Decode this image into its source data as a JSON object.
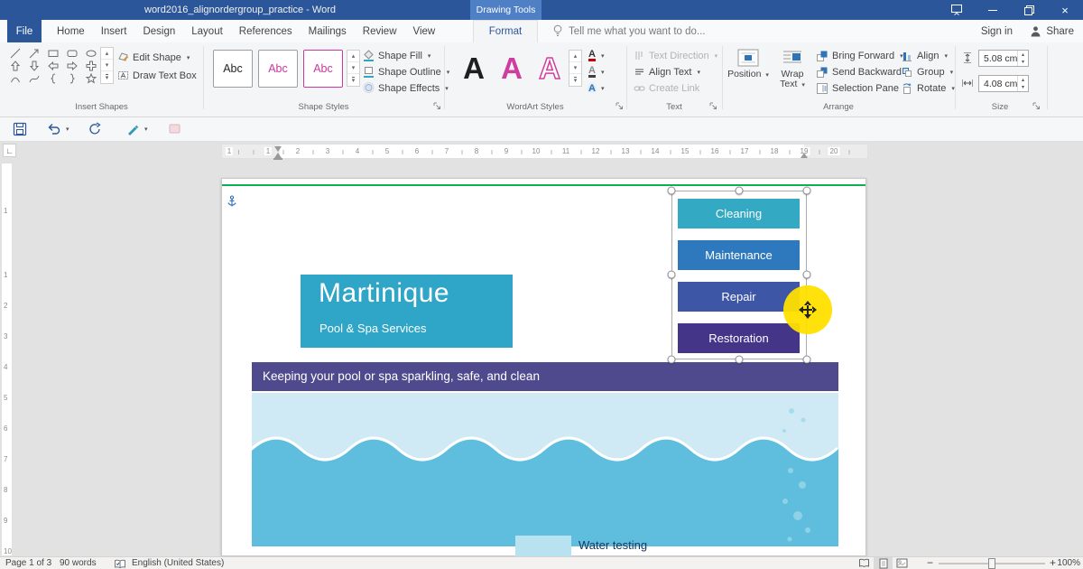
{
  "titlebar": {
    "title": "word2016_alignordergroup_practice - Word",
    "contextual_tab": "Drawing Tools"
  },
  "tabs": {
    "file": "File",
    "items": [
      "Home",
      "Insert",
      "Design",
      "Layout",
      "References",
      "Mailings",
      "Review",
      "View"
    ],
    "active": "Format"
  },
  "tellme": {
    "text": "Tell me what you want to do..."
  },
  "account": {
    "sign_in": "Sign in",
    "share": "Share"
  },
  "ribbon": {
    "insert_shapes": {
      "label": "Insert Shapes",
      "edit_shape": "Edit Shape",
      "draw_text_box": "Draw Text Box",
      "shapes": [
        "line",
        "arrow",
        "rectangle",
        "rounded-rectangle",
        "oval",
        "up-arrow",
        "down-arrow",
        "left-arrow",
        "right-arrow",
        "plus",
        "arc",
        "curve",
        "left-brace",
        "right-brace",
        "star"
      ]
    },
    "shape_styles": {
      "label": "Shape Styles",
      "samples": [
        "Abc",
        "Abc",
        "Abc"
      ],
      "shape_fill": "Shape Fill",
      "shape_outline": "Shape Outline",
      "shape_effects": "Shape Effects"
    },
    "wordart_styles": {
      "label": "WordArt Styles",
      "samples": [
        "A",
        "A",
        "A"
      ]
    },
    "text": {
      "label": "Text",
      "text_direction": "Text Direction",
      "align_text": "Align Text",
      "create_link": "Create Link"
    },
    "arrange": {
      "label": "Arrange",
      "position": "Position",
      "wrap_text": "Wrap Text",
      "bring_forward": "Bring Forward",
      "send_backward": "Send Backward",
      "selection_pane": "Selection Pane",
      "align": "Align",
      "group": "Group",
      "rotate": "Rotate"
    },
    "size": {
      "label": "Size",
      "height": "5.08 cm",
      "width": "4.08 cm"
    }
  },
  "ruler": {
    "horizontal": [
      "1",
      "1",
      "2",
      "3",
      "4",
      "5",
      "6",
      "7",
      "8",
      "9",
      "10",
      "11",
      "12",
      "13",
      "14",
      "15",
      "16",
      "17",
      "18",
      "19",
      "20"
    ],
    "vertical": [
      "1",
      "1",
      "2",
      "3",
      "4",
      "5",
      "6",
      "7",
      "8",
      "9",
      "10"
    ]
  },
  "document": {
    "logo_title": "Martinique",
    "logo_subtitle": "Pool & Spa Services",
    "buttons": [
      "Cleaning",
      "Maintenance",
      "Repair",
      "Restoration"
    ],
    "banner": "Keeping your pool or spa sparkling, safe, and clean",
    "list_item": "Water testing"
  },
  "statusbar": {
    "page": "Page 1 of 3",
    "words": "90 words",
    "language": "English (United States)",
    "zoom": "100%"
  },
  "colors": {
    "titlebar": "#2b579a",
    "contextual_tab": "#4f80c5",
    "logo_teal": "#2fa5c7",
    "btn_cleaning": "#33a9c4",
    "btn_maintenance": "#2e79bd",
    "btn_repair": "#3e56a6",
    "btn_restoration": "#453589",
    "banner_purple": "#4f4a8d",
    "water_light": "#cfeaf4",
    "water_dark": "#5fbedd",
    "highlight_yellow": "#ffe000",
    "guide_green": "#0faf54"
  }
}
